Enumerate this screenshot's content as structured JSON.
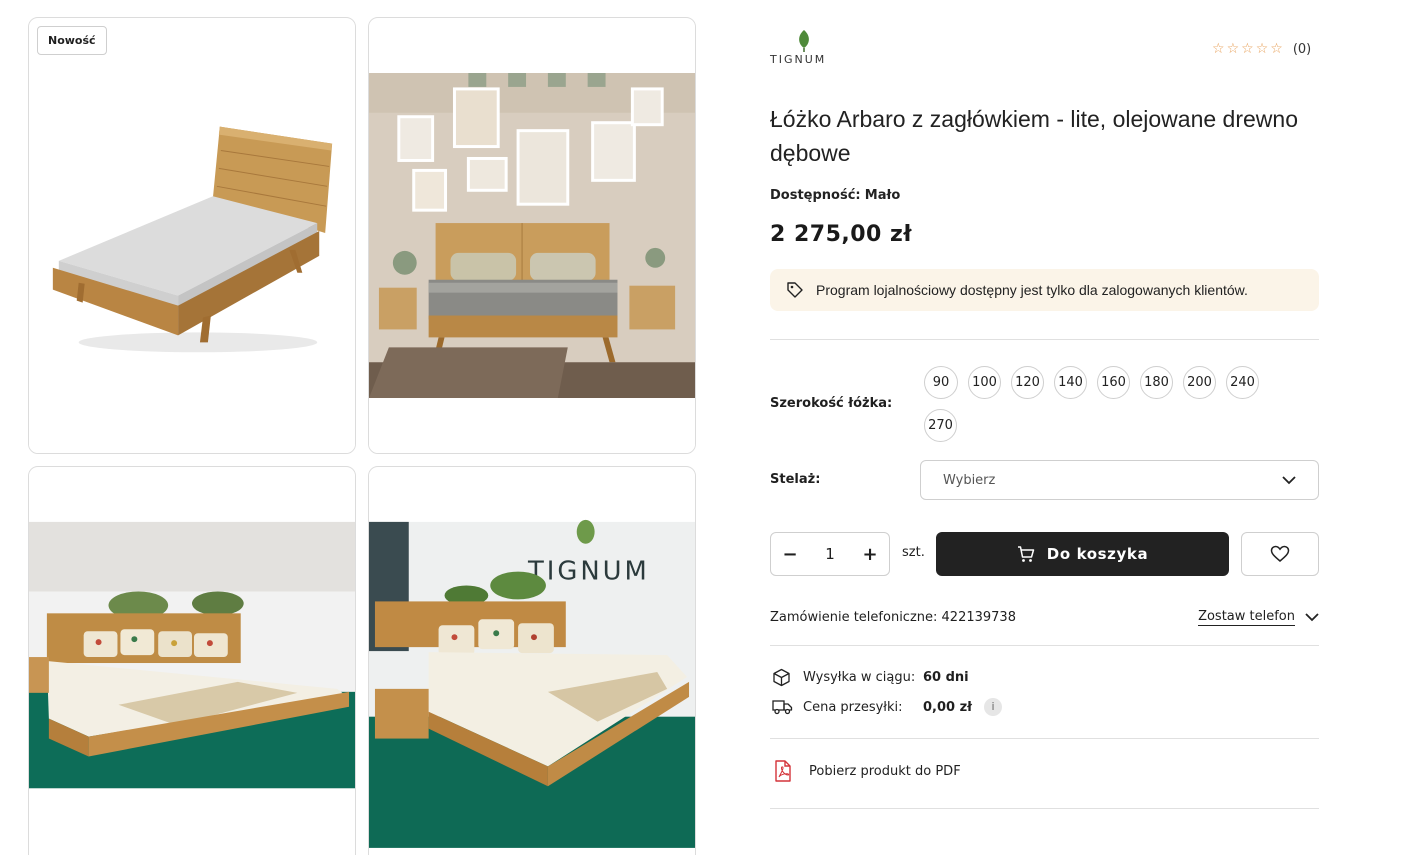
{
  "gallery": {
    "badge": "Nowość"
  },
  "brand": {
    "logo_text": "TIGNUM",
    "logo_icon": "leaf-icon"
  },
  "rating": {
    "stars": 0,
    "max_stars": 5,
    "count": "(0)"
  },
  "product": {
    "title": "Łóżko Arbaro z zagłówkiem - lite, olejowane drewno dębowe",
    "availability_label": "Dostępność:",
    "availability_value": "Mało",
    "price": "2 275,00 zł"
  },
  "loyalty": {
    "text": "Program lojalnościowy dostępny jest tylko dla zalogowanych klientów.",
    "icon": "tag-icon",
    "bg": "#fbf4e8"
  },
  "options": {
    "width_label": "Szerokość łóżka:",
    "widths": [
      "90",
      "100",
      "120",
      "140",
      "160",
      "180",
      "200",
      "240",
      "270"
    ],
    "frame_label": "Stelaż:",
    "frame_placeholder": "Wybierz"
  },
  "purchase": {
    "quantity": "1",
    "minus": "−",
    "plus": "+",
    "unit": "szt.",
    "cart_label": "Do koszyka",
    "cart_bg": "#222222"
  },
  "phone_order": {
    "label": "Zamówienie telefoniczne:",
    "number": "422139738",
    "leave_phone": "Zostaw telefon"
  },
  "shipping": {
    "time_label": "Wysyłka w ciągu:",
    "time_value": "60 dni",
    "cost_label": "Cena przesyłki:",
    "cost_value": "0,00 zł",
    "info": "i"
  },
  "pdf": {
    "label": "Pobierz produkt do PDF"
  }
}
